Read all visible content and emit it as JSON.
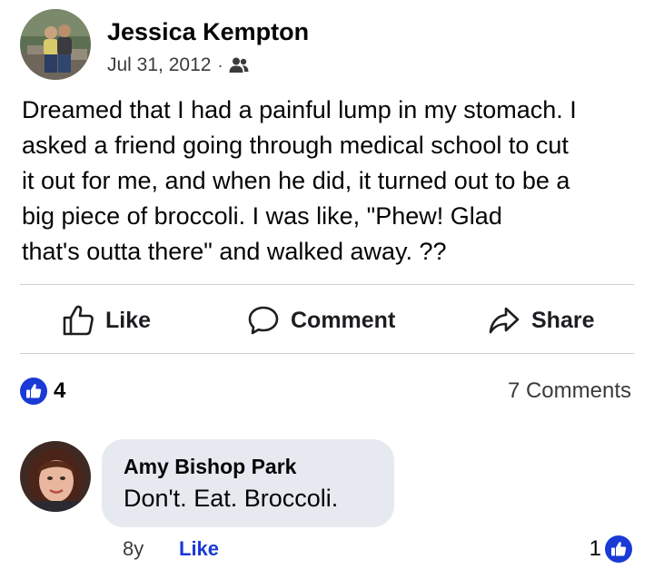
{
  "post": {
    "author": "Jessica Kempton",
    "date": "Jul 31, 2012",
    "separator": "·",
    "audience_icon": "friends-icon",
    "body": "Dreamed that I had a painful lump in my stomach.  I\nasked a friend going through medical school to cut\nit out for me, and when he did, it turned out to be a\nbig piece of broccoli.  I was like, \"Phew!  Glad\nthat's outta there\" and walked away. ??"
  },
  "actions": {
    "like_label": "Like",
    "comment_label": "Comment",
    "share_label": "Share"
  },
  "stats": {
    "like_count": "4",
    "comments_label": "7 Comments"
  },
  "comment": {
    "author": "Amy Bishop Park",
    "text": "Don't. Eat. Broccoli.",
    "time": "8y",
    "like_label": "Like",
    "reaction_count": "1"
  },
  "colors": {
    "accent": "#1a3ad6",
    "bubble": "#e6e9f0",
    "divider": "#ced0d4"
  }
}
